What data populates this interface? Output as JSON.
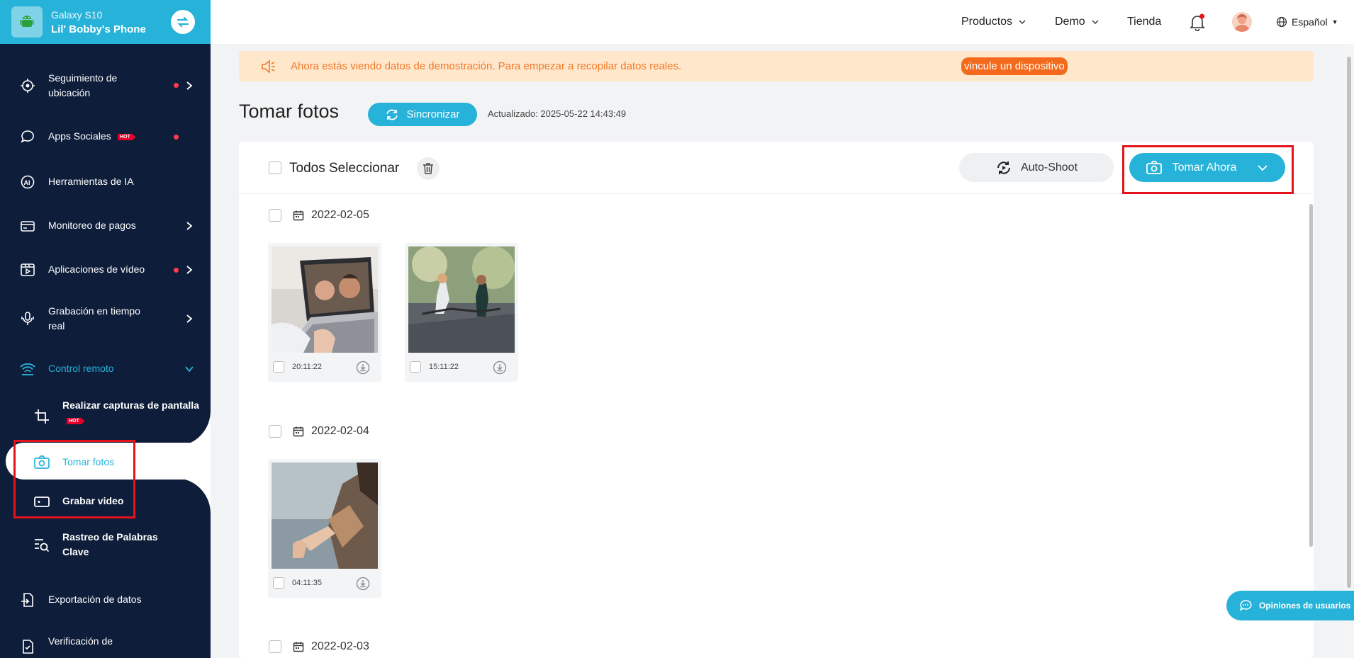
{
  "device": {
    "model": "Galaxy S10",
    "name": "Lil' Bobby's Phone"
  },
  "topbar": {
    "productos": "Productos",
    "demo": "Demo",
    "tienda": "Tienda",
    "language": "Español"
  },
  "sidebar": {
    "items": [
      {
        "label": "Seguimiento de ubicación"
      },
      {
        "label": "Apps Sociales",
        "badge": "HOT"
      },
      {
        "label": "Herramientas de IA"
      },
      {
        "label": "Monitoreo de pagos"
      },
      {
        "label": "Aplicaciones de vídeo"
      },
      {
        "label": "Grabación en tiempo real"
      },
      {
        "label": "Control remoto"
      },
      {
        "label": "Exportación de datos"
      },
      {
        "label": "Verificación de"
      }
    ],
    "subitems": [
      {
        "label": "Realizar capturas de pantalla",
        "badge": "HOT"
      },
      {
        "label": "Tomar fotos"
      },
      {
        "label": "Grabar video"
      },
      {
        "label": "Rastreo de Palabras Clave"
      }
    ]
  },
  "banner": {
    "text": "Ahora estás viendo datos de demostración. Para empezar a recopilar datos reales.",
    "link": "vincule un dispositivo"
  },
  "page": {
    "title": "Tomar fotos",
    "sync_label": "Sincronizar",
    "updated": "Actualizado: 2025-05-22 14:43:49"
  },
  "toolbar": {
    "select_all": "Todos Seleccionar",
    "auto_shoot": "Auto-Shoot",
    "take_now": "Tomar Ahora"
  },
  "groups": [
    {
      "date": "2022-02-05",
      "photos": [
        {
          "time": "20:11:22"
        },
        {
          "time": "15:11:22"
        }
      ]
    },
    {
      "date": "2022-02-04",
      "photos": [
        {
          "time": "04:11:35"
        }
      ]
    },
    {
      "date": "2022-02-03",
      "photos": []
    }
  ],
  "feedback": {
    "label": "Opiniones de usuarios"
  },
  "colors": {
    "accent": "#27b3d9",
    "sidebar": "#0e1d3a",
    "alert": "#e4121b",
    "banner_bg": "#ffe7cc",
    "banner_text": "#f07a2a"
  }
}
